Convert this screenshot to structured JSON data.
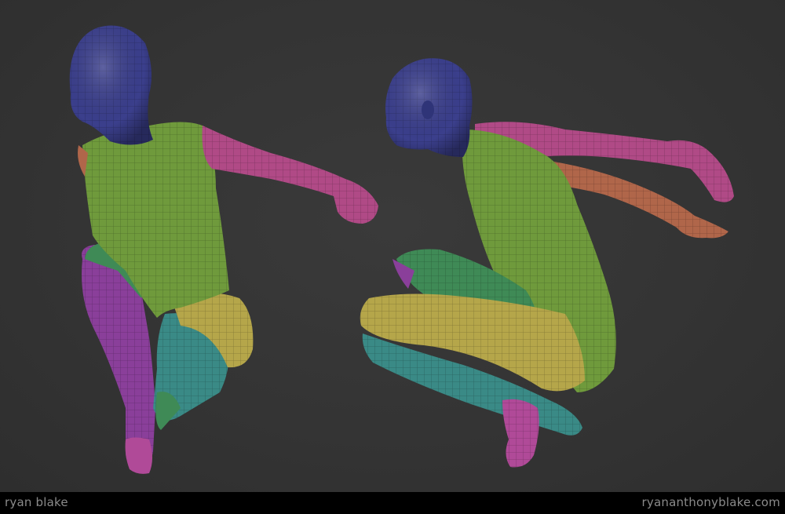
{
  "footer": {
    "left_text": "ryan blake",
    "right_text": "ryananthonyblake.com"
  },
  "colors": {
    "background": "#333333",
    "footer_bar": "#000000",
    "footer_text": "#8a8a8a",
    "head": "#3b3f8c",
    "torso": "#6f9a3c",
    "arm_left": "#b04a86",
    "arm_right": "#b0664a",
    "thigh": "#b5a64a",
    "shin": "#3a8a86",
    "leg_purple": "#8a3f9a",
    "foot": "#b04a98"
  },
  "scene": {
    "figure_left": "sculpt-figure-front-view",
    "figure_right": "sculpt-figure-side-view"
  }
}
